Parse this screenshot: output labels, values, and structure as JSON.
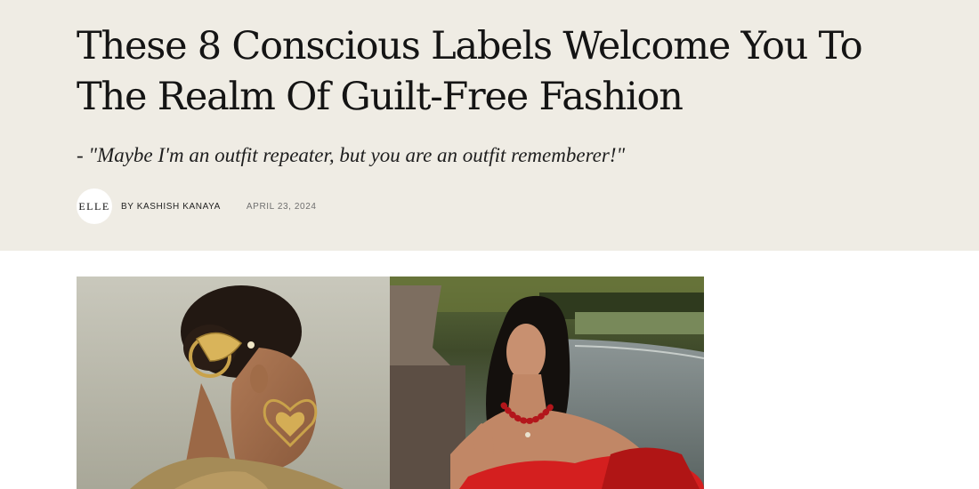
{
  "article": {
    "title": "These 8 Conscious Labels Welcome You To The Realm Of Guilt-Free Fashion",
    "subtitle": "- \"Maybe I'm an outfit repeater, but you are an outfit rememberer!\"",
    "publication_logo": "ELLE",
    "author": "BY KASHISH KANAYA",
    "date": "APRIL 23, 2024"
  },
  "colors": {
    "hero_background": "#efece4",
    "text": "#141414",
    "date_text": "#6f6f6f"
  }
}
